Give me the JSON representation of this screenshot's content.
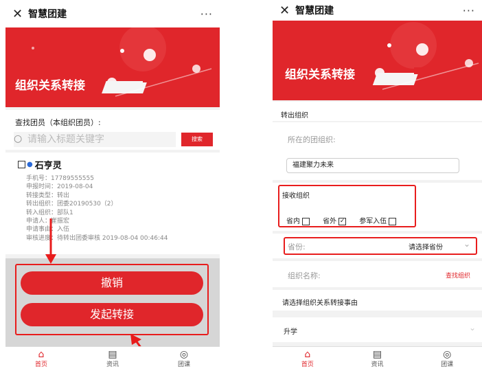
{
  "left": {
    "window_title": "智慧团建",
    "close_glyph": "✕",
    "more_glyph": "···",
    "banner_title": "组织关系转接",
    "search_label": "查找团员（本组织团员）:",
    "search_placeholder": "请输入标题关键字",
    "search_button": "搜索",
    "member": {
      "name": "石亨灵",
      "lines": [
        "手机号：17789555555",
        "申报时间：2019-08-04",
        "转接类型：转出",
        "转出组织：团委20190530（2）",
        "转入组织：部队1",
        "申请人：崔振宏",
        "申请事由：入伍",
        "审核进度：待转出团委审核 2019-08-04 00:46:44"
      ]
    },
    "cancel_button": "撤销",
    "transfer_button": "发起转接",
    "tabs": [
      {
        "label": "首页",
        "icon": "home-icon",
        "glyph": "⌂"
      },
      {
        "label": "资讯",
        "icon": "news-icon",
        "glyph": "▤"
      },
      {
        "label": "团课",
        "icon": "course-icon",
        "glyph": "◎"
      }
    ]
  },
  "right": {
    "window_title": "智慧团建",
    "close_glyph": "✕",
    "more_glyph": "···",
    "banner_title": "组织关系转接",
    "out_section_title": "转出组织",
    "out_org_label": "所在的团组织:",
    "out_org_value": "福建聚力未来",
    "receive_title": "接收组织",
    "options": [
      {
        "label": "省内",
        "checked": false
      },
      {
        "label": "省外",
        "checked": true
      },
      {
        "label": "参军入伍",
        "checked": false
      }
    ],
    "province_label": "省份:",
    "province_value": "请选择省份",
    "org_name_label": "组织名称:",
    "find_org_link": "查找组织",
    "reason_prompt": "请选择组织关系转接事由",
    "reason_value": "升学",
    "tabs": [
      {
        "label": "首页",
        "icon": "home-icon",
        "glyph": "⌂"
      },
      {
        "label": "资讯",
        "icon": "news-icon",
        "glyph": "▤"
      },
      {
        "label": "团课",
        "icon": "course-icon",
        "glyph": "◎"
      }
    ]
  },
  "colors": {
    "brand_red": "#e0262b",
    "annotation_red": "#e81c1c"
  }
}
